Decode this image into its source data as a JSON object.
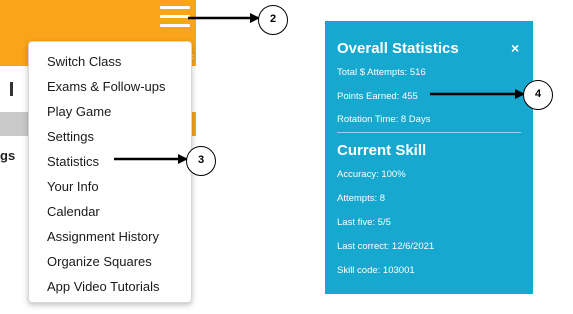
{
  "app": {
    "stub_text": "gs",
    "stub_close": "×"
  },
  "menu": {
    "items": [
      {
        "label": "Switch Class"
      },
      {
        "label": "Exams & Follow-ups"
      },
      {
        "label": "Play Game"
      },
      {
        "label": "Settings"
      },
      {
        "label": "Statistics"
      },
      {
        "label": "Your Info"
      },
      {
        "label": "Calendar"
      },
      {
        "label": "Assignment History"
      },
      {
        "label": "Organize Squares"
      },
      {
        "label": "App Video Tutorials"
      }
    ]
  },
  "stats": {
    "overall_title": "Overall Statistics",
    "close_symbol": "×",
    "total_attempts": "Total $ Attempts: 516",
    "points_earned": "Points Earned: 455",
    "rotation_time": "Rotation Time: 8 Days",
    "current_skill_title": "Current Skill",
    "accuracy": "Accuracy: 100%",
    "attempts": "Attempts: 8",
    "last_five": "Last five: 5/5",
    "last_correct": "Last correct: 12/6/2021",
    "skill_code": "Skill code: 103001"
  },
  "callouts": {
    "hamburger": "2",
    "statistics": "3",
    "points": "4"
  },
  "colors": {
    "header_orange": "#f9a51a",
    "panel_blue": "#16a8cf",
    "menu_bg": "#ffffff"
  },
  "icons": {
    "hamburger": "hamburger-menu-icon",
    "close": "close-icon",
    "arrow": "arrow-left-icon"
  }
}
